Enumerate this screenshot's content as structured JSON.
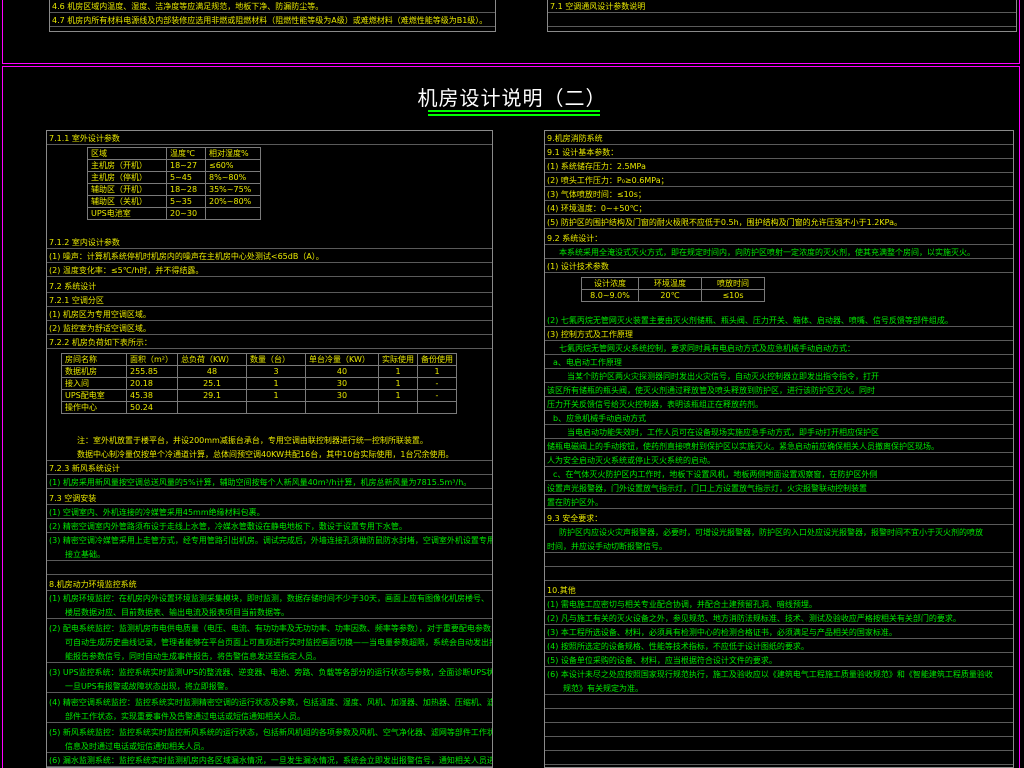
{
  "top_snippets": {
    "left_1": "4.6 机房区域内温度、湿度、洁净度等应满足规范，地板下净、防漏防尘等。",
    "left_2": "4.7 机房内所有材料电源线及内部装修应选用非燃或阻燃材料（阻燃性能等级为A级）或难燃材料（难燃性能等级为B1级）。",
    "right_1": "7.1 空调通风设计参数说明"
  },
  "page_title": "机房设计说明（二）",
  "left": {
    "s711": "7.1.1 室外设计参数",
    "env_table": {
      "headers": [
        "区域",
        "温度℃",
        "相对湿度%"
      ],
      "rows": [
        [
          "主机房（开机）",
          "18~27",
          "≤60%"
        ],
        [
          "主机房（停机）",
          "5~45",
          "8%~80%"
        ],
        [
          "辅助区（开机）",
          "18~28",
          "35%~75%"
        ],
        [
          "辅助区（关机）",
          "5~35",
          "20%~80%"
        ],
        [
          "UPS电池室",
          "20~30",
          ""
        ]
      ]
    },
    "s712": "7.1.2 室内设计参数",
    "s712_1": "(1) 噪声：计算机系统停机时机房内的噪声在主机房中心处测试<65dB（A）。",
    "s712_2": "(2) 温度变化率：≤5℃/h时，并不得结露。",
    "s72": "7.2 系统设计",
    "s721": "7.2.1 空调分区",
    "s721_1": "(1) 机房区为专用空调区域。",
    "s721_2": "(2) 监控室为舒适空调区域。",
    "s722": "7.2.2 机房负荷如下表所示：",
    "load_table": {
      "headers": [
        "房间名称",
        "面积（m²）",
        "总负荷（KW）",
        "数量（台）",
        "单台冷量（KW）",
        "实际使用",
        "备份使用"
      ],
      "rows": [
        [
          "数据机房",
          "255.85",
          "48",
          "3",
          "40",
          "1",
          "1"
        ],
        [
          "接入间",
          "20.18",
          "25.1",
          "1",
          "30",
          "1",
          "-"
        ],
        [
          "UPS配电室",
          "45.38",
          "29.1",
          "1",
          "30",
          "1",
          "-"
        ],
        [
          "操作中心",
          "50.24",
          "",
          "",
          "",
          "",
          ""
        ]
      ]
    },
    "note1": "注：室外机放置于楼平台，并设200mm减振台承台，专用空调由联控制器进行统一控制所联装置。",
    "note2": "数据中心制冷量仅按单个冷通道计算，总体间预空调40KW共配16台，其中10台实际使用，1台冗余使用。",
    "s723": "7.2.3 新风系统设计",
    "s723_1": "(1) 机房采用新风量按空调总送风量的5%计算，辅助空间按每个人新风量40m³/h计算，机房总新风量为7815.5m³/h。",
    "s73": "7.3 空调安装",
    "s73_1": "(1) 空调室内、外机连接的冷媒管采用45mm绝缘材料包裹。",
    "s73_2": "(2) 精密空调室内外管路须布设于走线上水管，冷媒水管敷设在静电地板下，敷设于设置专用下水管。",
    "s73_3": "(3) 精密空调冷媒管采用上走管方式，经专用管路引出机房。调试完成后，外墙连接孔须做防鼠防水封堵，空调室外机设置专用",
    "s73_3b": "接立基础。",
    "s8": "8.机房动力环境监控系统",
    "s8_1": "(1) 机房环境监控：在机房内外设置环境监测采集模块，即时监测，数据存储时间不少于30天，画面上应有图像化机房楼号、",
    "s8_1b": "楼层数据对应、目前数据表、输出电流及报表项目当前数据等。",
    "s8_2": "(2) 配电系统监控：监测机房市电供电质量（电压、电流、有功功率及无功功率、功率因数、频率等参数），对于重要配电参数，",
    "s8_2b": "可自动生成历史曲线记录，管理者能够在平台页面上可直观进行实时监控画面切换——当电量参数超限，系统会自动发出报警提示，",
    "s8_2c": "能报告参数信号，同时自动生成事件报告，将告警信息发送至指定人员。",
    "s8_3": "(3) UPS监控系统：监控系统实时监测UPS的整流器、逆变器、电池、旁路、负载等各部分的运行状态与参数，全面诊断UPS状况，",
    "s8_3b": "一旦UPS有报警或故障状态出现，将立即报警。",
    "s8_4": "(4) 精密空调系统监控：监控系统实时监测精密空调的运行状态及参数，包括温度、湿度、风机、加湿器、加热器、压缩机、滤网等",
    "s8_4b": "部件工作状态，实现重要事件及告警通过电话或短信通知相关人员。",
    "s8_5": "(5) 新风系统监控：监控系统实时监控新风系统的运行状态，包括新风机组的各项参数及风机、空气净化器、滤网等部件工作状态，出现报警",
    "s8_5b": "信息及时通过电话或短信通知相关人员。",
    "s8_6": "(6) 漏水监测系统：监控系统实时监测机房内各区域漏水情况，一旦发生漏水情况，系统会立即发出报警信号，通知相关人员进行处理。"
  },
  "right": {
    "s9": "9.机房消防系统",
    "s91": "9.1 设计基本参数：",
    "s91_1": "(1) 系统储存压力：2.5MPa",
    "s91_2": "(2) 喷头工作压力：P₀≥0.6MPa；",
    "s91_3": "(3) 气体喷放时间：≤10s；",
    "s91_4": "(4) 环境温度：0~+50℃；",
    "s91_5": "(5) 防护区的围护结构及门窗的耐火极限不应低于0.5h，围护结构及门窗的允许压强不小于1.2KPa。",
    "s92": "9.2 系统设计：",
    "s92_0": "本系统采用全淹没式灭火方式，即在规定时间内，向防护区喷射一定浓度的灭火剂，使其充满整个房间，以实施灭火。",
    "s92_1": "(1) 设计技术参数",
    "fire_table": {
      "headers": [
        "设计浓度",
        "环境温度",
        "喷放时间"
      ],
      "rows": [
        [
          "8.0~9.0%",
          "20℃",
          "≤10s"
        ]
      ]
    },
    "s92_2": "(2) 七氟丙烷无管网灭火装置主要由灭火剂储瓶、瓶头阀、压力开关、箱体、启动器、喷嘴、信号反馈等部件组成。",
    "s92_3": "(3) 控制方式及工作原理",
    "s92_3a": "七氟丙烷无管网灭火系统控制，要求同时具有电启动方式及应急机械手动启动方式：",
    "s92_a": "a、电启动工作原理",
    "s92_a1": "当某个防护区两火灾探测器同时发出火灾信号，自动灭火控制器立即发出指令指令，打开",
    "s92_a2": "该区所有储瓶的瓶头阀，使灭火剂通过释放管及喷头释放到防护区，进行该防护区灭火。同时",
    "s92_a3": "压力开关反馈信号给灭火控制器，表明该瓶组正在释放药剂。",
    "s92_b": "b、应急机械手动启动方式",
    "s92_b1": "当电启动功能失效时，工作人员可在设备现场实施应急手动方式，即手动打开相应保护区",
    "s92_b2": "储瓶电磁阀上的手动按钮，使药剂直接喷射到保护区以实施灭火。紧急启动前应确保相关人员撤离保护区现场。",
    "s92_b3": "人为安全启动灭火系统或停止灭火系统的启动。",
    "s92_c": "c、在气体灭火防护区内工作时，地板下设置风机，地板两侧地面设置观察窗，在防护区外侧",
    "s92_c1": "设置声光报警器，门外设置放气指示灯，门口上方设置放气指示灯，火灾报警联动控制装置",
    "s92_c2": "置在防护区外。",
    "s93": "9.3 安全要求：",
    "s93_1": "防护区内应设火灾声报警器，必要时，可增设光报警器，防护区的入口处应设光报警器，报警时间不宜小于灭火剂的喷放",
    "s93_2": "时间，并应设手动切断报警信号。",
    "s10": "10.其他",
    "s10_1": "(1) 需电施工应密切与相关专业配合协调，并配合土建预留孔洞、暗线预埋。",
    "s10_2": "(2) 凡与施工有关的灭火设备之外，参见规范、地方消防法规标准、技术、测试及验收应严格按相关有关部门的要求。",
    "s10_3": "(3) 本工程所选设备、材料，必须具有检测中心的检测合格证书，必须满足与产品相关的国家标准。",
    "s10_4": "(4) 按照所选定的设备规格、性能等技术指标，不应低于设计图纸的要求。",
    "s10_5": "(5) 设备单位采购的设备、材料，应当根据符合设计文件的要求。",
    "s10_6": "(6) 本设计未尽之处应按照国家现行规范执行，施工及验收应以《建筑电气工程施工质量验收规范》和《智能建筑工程质量验收",
    "s10_6b": "规范》有关规定为准。"
  }
}
